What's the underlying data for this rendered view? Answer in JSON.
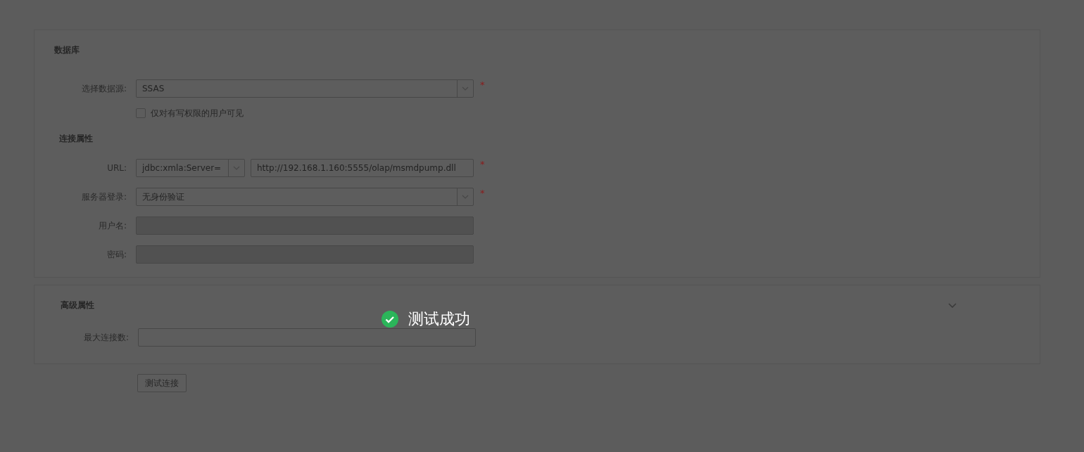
{
  "database_panel": {
    "title": "数据库",
    "source_field": {
      "label": "选择数据源:",
      "value": "SSAS",
      "required_mark": "*"
    },
    "checkbox": {
      "label": "仅对有写权限的用户可见",
      "checked": false
    },
    "section_title": "连接属性",
    "fields": [
      {
        "kind": "url",
        "label": "URL:",
        "prefix": "jdbc:xmla:Server=",
        "value": "http://192.168.1.160:5555/olap/msmdpump.dll",
        "required_mark": "*"
      },
      {
        "kind": "select",
        "label": "服务器登录:",
        "value": "无身份验证",
        "required_mark": "*"
      },
      {
        "kind": "input",
        "label": "用户名:",
        "disabled": true
      },
      {
        "kind": "input",
        "label": "密码:",
        "disabled": true
      }
    ]
  },
  "advanced_panel": {
    "title": "高级属性",
    "expanded": true,
    "fields": [
      {
        "kind": "input",
        "label": "最大连接数:",
        "disabled": false
      }
    ]
  },
  "test_button": "测试连接",
  "toast": {
    "message": "测试成功"
  }
}
